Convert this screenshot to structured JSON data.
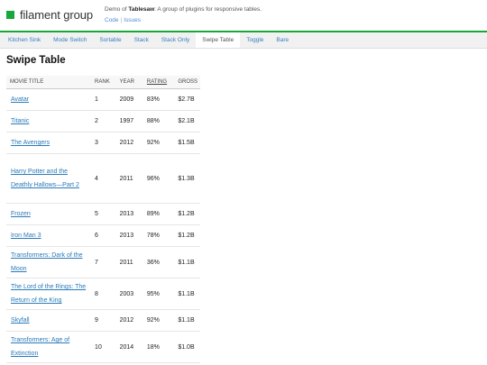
{
  "header": {
    "brand": "filament group",
    "demo_prefix": "Demo of ",
    "demo_product": "Tablesaw",
    "demo_suffix": ": A group of plugins for responsive tables.",
    "links": [
      "Code",
      "Issues"
    ]
  },
  "nav": [
    "Kitchen Sink",
    "Mode Switch",
    "Sortable",
    "Stack",
    "Stack Only",
    "Swipe Table",
    "Toggle",
    "Bare"
  ],
  "nav_active": "Swipe Table",
  "page_title": "Swipe Table",
  "table": {
    "columns": [
      "MOVIE TITLE",
      "RANK",
      "YEAR",
      "RATING",
      "GROSS"
    ],
    "rows": [
      [
        "Avatar",
        "1",
        "2009",
        "83%",
        "$2.7B"
      ],
      [
        "Titanic",
        "2",
        "1997",
        "88%",
        "$2.1B"
      ],
      [
        "The Avengers",
        "3",
        "2012",
        "92%",
        "$1.5B"
      ],
      [
        "Harry Potter and the Deathly Hallows—Part 2",
        "4",
        "2011",
        "96%",
        "$1.3B"
      ],
      [
        "Frozen",
        "5",
        "2013",
        "89%",
        "$1.2B"
      ],
      [
        "Iron Man 3",
        "6",
        "2013",
        "78%",
        "$1.2B"
      ],
      [
        "Transformers: Dark of the Moon",
        "7",
        "2011",
        "36%",
        "$1.1B"
      ],
      [
        "The Lord of the Rings: The Return of the King",
        "8",
        "2003",
        "95%",
        "$1.1B"
      ],
      [
        "Skyfall",
        "9",
        "2012",
        "92%",
        "$1.1B"
      ],
      [
        "Transformers: Age of Extinction",
        "10",
        "2014",
        "18%",
        "$1.0B"
      ]
    ]
  },
  "colors": {
    "brand_green": "#16a83b",
    "link_blue": "#2a7ab8"
  }
}
